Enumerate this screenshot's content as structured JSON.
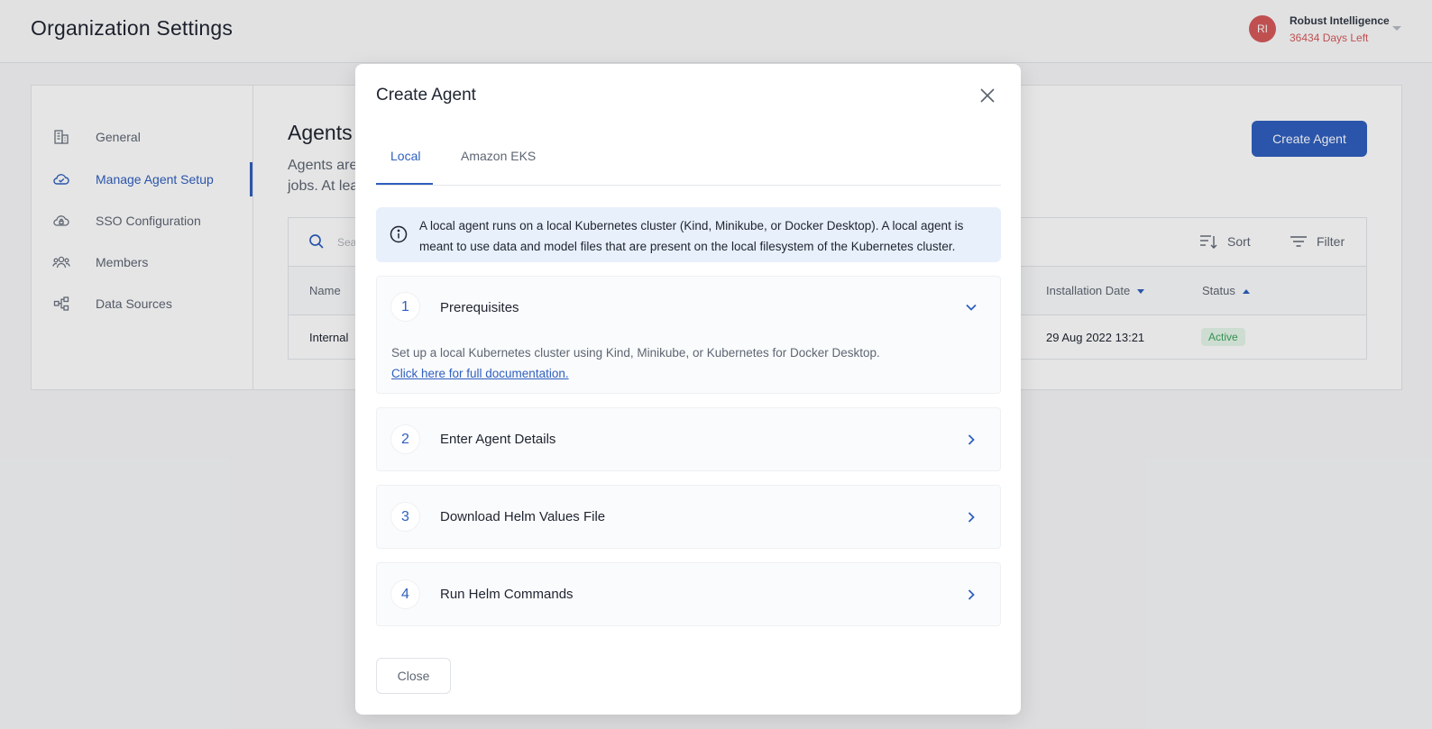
{
  "header": {
    "title": "Organization Settings",
    "avatar_initials": "RI",
    "org_name": "Robust Intelligence",
    "days_left": "36434 Days Left"
  },
  "sidebar": {
    "items": [
      {
        "label": "General",
        "icon": "building-icon"
      },
      {
        "label": "Manage Agent Setup",
        "icon": "cloud-check-icon",
        "active": true
      },
      {
        "label": "SSO Configuration",
        "icon": "cloud-lock-icon"
      },
      {
        "label": "Members",
        "icon": "people-icon"
      },
      {
        "label": "Data Sources",
        "icon": "data-sources-icon"
      }
    ]
  },
  "main": {
    "title": "Agents",
    "description_line1": "Agents are",
    "description_line2": "jobs. At lea",
    "create_button": "Create Agent",
    "search_placeholder": "Sea",
    "sort_label": "Sort",
    "filter_label": "Filter",
    "table": {
      "columns": [
        "Name",
        "Installation Date",
        "Status"
      ],
      "rows": [
        {
          "name": "Internal ",
          "installation_date": "29 Aug 2022 13:21",
          "status": "Active"
        }
      ]
    }
  },
  "modal": {
    "title": "Create Agent",
    "tabs": [
      {
        "label": "Local",
        "active": true
      },
      {
        "label": "Amazon EKS",
        "active": false
      }
    ],
    "info_text": "A local agent runs on a local Kubernetes cluster (Kind, Minikube, or Docker Desktop). A local agent is meant to use data and model files that are present on the local filesystem of the Kubernetes cluster.",
    "steps": [
      {
        "number": "1",
        "title": "Prerequisites",
        "expanded": true,
        "body": "Set up a local Kubernetes cluster using Kind, Minikube, or Kubernetes for Docker Desktop.",
        "link": "Click here for full documentation."
      },
      {
        "number": "2",
        "title": "Enter Agent Details",
        "expanded": false
      },
      {
        "number": "3",
        "title": "Download Helm Values File",
        "expanded": false
      },
      {
        "number": "4",
        "title": "Run Helm Commands",
        "expanded": false
      }
    ],
    "close_button": "Close"
  },
  "colors": {
    "accent": "#2f5fbf",
    "avatar": "#d65a5a",
    "info_bg": "#e7f0fb",
    "status_active": "#3aa35a"
  }
}
